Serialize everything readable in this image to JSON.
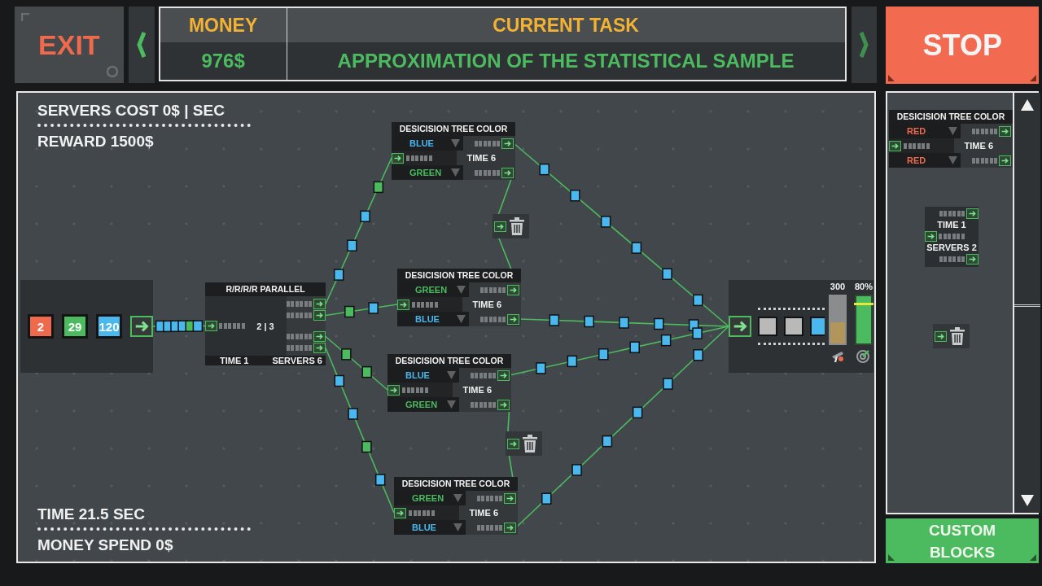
{
  "header": {
    "exit": "EXIT",
    "money_label": "MONEY",
    "money": "976$",
    "task_label": "CURRENT TASK",
    "task": "APPROXIMATION OF THE STATISTICAL SAMPLE",
    "stop": "STOP"
  },
  "stats": {
    "servers_cost": "SERVERS COST 0$ | SEC",
    "reward": "REWARD 1500$",
    "time": "TIME 21.5 SEC",
    "money_spend": "MONEY SPEND 0$"
  },
  "nodes": [
    {
      "kind": "source",
      "chips": [
        {
          "value": "2",
          "color": "#ef6a4c"
        },
        {
          "value": "29",
          "color": "#4cbb5f"
        },
        {
          "value": "120",
          "color": "#4ab8ee"
        }
      ],
      "packets": [
        {
          "color": "#4ab8ee"
        },
        {
          "color": "#4ab8ee"
        },
        {
          "color": "#4ab8ee"
        },
        {
          "color": "#4ab8ee"
        },
        {
          "color": "#4cbb5f"
        },
        {
          "color": "#4ab8ee"
        }
      ]
    },
    {
      "kind": "parallel",
      "title": "R/R/R/R PARALLEL",
      "ratio": "2 | 3",
      "time": "TIME 1",
      "servers": "SERVERS 6",
      "outputs": [
        {
          "packets": [
            {
              "color": "#4ab8ee"
            },
            {
              "color": "#4ab8ee"
            },
            {
              "color": "#4ab8ee"
            },
            {
              "color": "#4cbb5f"
            }
          ]
        },
        {
          "packets": [
            {
              "color": "#4cbb5f"
            },
            {
              "color": "#4ab8ee"
            }
          ]
        },
        {
          "packets": [
            {
              "color": "#4cbb5f"
            },
            {
              "color": "#4cbb5f"
            }
          ]
        },
        {
          "packets": [
            {
              "color": "#4ab8ee"
            },
            {
              "color": "#4ab8ee"
            },
            {
              "color": "#4cbb5f"
            },
            {
              "color": "#4ab8ee"
            }
          ]
        }
      ]
    },
    {
      "kind": "decision",
      "title": "DESICISION TREE COLOR",
      "time": "TIME 6",
      "outputs": [
        {
          "label": "BLUE",
          "color": "#4ab8ee",
          "packets": [
            {
              "color": "#4ab8ee"
            },
            {
              "color": "#4ab8ee"
            },
            {
              "color": "#4ab8ee"
            },
            {
              "color": "#4ab8ee"
            },
            {
              "color": "#4ab8ee"
            },
            {
              "color": "#4ab8ee"
            }
          ]
        },
        {
          "label": "GREEN",
          "color": "#4cbb5f"
        }
      ]
    },
    {
      "kind": "decision",
      "title": "DESICISION TREE COLOR",
      "time": "TIME 6",
      "outputs": [
        {
          "label": "GREEN",
          "color": "#4cbb5f"
        },
        {
          "label": "BLUE",
          "color": "#4ab8ee",
          "packets": [
            {
              "color": "#4ab8ee"
            },
            {
              "color": "#4ab8ee"
            },
            {
              "color": "#4ab8ee"
            },
            {
              "color": "#4ab8ee"
            },
            {
              "color": "#4ab8ee"
            }
          ]
        }
      ]
    },
    {
      "kind": "decision",
      "title": "DESICISION TREE COLOR",
      "time": "TIME 6",
      "outputs": [
        {
          "label": "BLUE",
          "color": "#4ab8ee",
          "packets": [
            {
              "color": "#4ab8ee"
            },
            {
              "color": "#4ab8ee"
            },
            {
              "color": "#4ab8ee"
            },
            {
              "color": "#4ab8ee"
            },
            {
              "color": "#4ab8ee"
            },
            {
              "color": "#4ab8ee"
            }
          ]
        },
        {
          "label": "GREEN",
          "color": "#4cbb5f"
        }
      ]
    },
    {
      "kind": "decision",
      "title": "DESICISION TREE COLOR",
      "time": "TIME 6",
      "outputs": [
        {
          "label": "GREEN",
          "color": "#4cbb5f"
        },
        {
          "label": "BLUE",
          "color": "#4ab8ee",
          "packets": [
            {
              "color": "#4ab8ee"
            },
            {
              "color": "#4ab8ee"
            },
            {
              "color": "#4ab8ee"
            },
            {
              "color": "#4ab8ee"
            },
            {
              "color": "#4ab8ee"
            },
            {
              "color": "#4ab8ee"
            }
          ]
        }
      ]
    },
    {
      "kind": "trash"
    },
    {
      "kind": "trash"
    },
    {
      "kind": "output",
      "slots": [
        {
          "color": "#b9b9b9"
        },
        {
          "color": "#b9b9b9"
        },
        {
          "color": "#4ab8ee"
        }
      ],
      "meters": [
        {
          "kind": "count",
          "reading": "300",
          "level": 0.45
        },
        {
          "kind": "accuracy",
          "reading": "80%",
          "level": 1
        }
      ]
    }
  ],
  "palette": [
    {
      "kind": "decision",
      "title": "DESICISION TREE COLOR",
      "time": "TIME 6",
      "outputs": [
        {
          "label": "RED",
          "color": "#ef6a4c"
        },
        {
          "label": "RED",
          "color": "#ef6a4c"
        }
      ]
    },
    {
      "kind": "splitter",
      "time": "TIME 1",
      "servers": "SERVERS 2"
    },
    {
      "kind": "trash"
    }
  ],
  "custom_blocks": "CUSTOM BLOCKS"
}
